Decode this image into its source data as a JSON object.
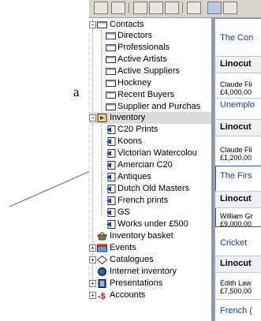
{
  "left_text": "a",
  "tree": {
    "contacts": {
      "label": "Contacts",
      "children": [
        "Directors",
        "Professionals",
        "Active Artists",
        "Active Suppliers",
        "Hockney",
        "Recent Buyers",
        "Supplier and Purchas"
      ]
    },
    "inventory": {
      "label": "Inventory",
      "children": [
        "C20 Prints",
        "Koons",
        "Victorian Watercolou",
        "Amercian C20",
        "Antiques",
        "Dutch Old Masters",
        "French prints",
        "GS",
        "Works under £500"
      ]
    },
    "others": [
      "Inventory basket",
      "Events",
      "Catalogues",
      "Internet inventory",
      "Presentations",
      "Accounts"
    ]
  },
  "cards": [
    {
      "title": "The Con",
      "category": "Linocut",
      "artist": "Claude Fli",
      "price": "£4,000.00"
    },
    {
      "title": "Unemplo",
      "category": "Linocut",
      "artist": "Claude Fli",
      "price": "£1,200.00"
    },
    {
      "title": "The Firs",
      "category": "Linocut",
      "artist": "William Gr",
      "price": "£9,000.00"
    },
    {
      "title": "Cricket",
      "category": "Linocut",
      "artist": "Edith Law",
      "price": "£7,500.00"
    },
    {
      "title": "French (",
      "category": "",
      "artist": "",
      "price": ""
    }
  ],
  "colors": {
    "card_title": "#1a3c9c",
    "selection": "#dcdcdc",
    "highlight_border": "#2b52c8"
  },
  "icons": {
    "contact_card": "address-card-icon",
    "inventory_item": "artwork-icon",
    "basket": "basket-icon",
    "events": "events-icon",
    "catalogues": "catalogue-icon",
    "internet": "globe-icon",
    "presentations": "presentation-icon",
    "accounts": "accounts-icon"
  }
}
